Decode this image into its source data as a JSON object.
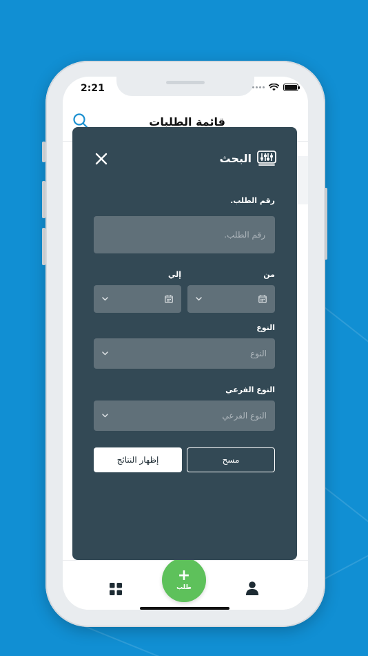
{
  "status_bar": {
    "time": "2:21"
  },
  "header": {
    "title": "قائمة الطلبات"
  },
  "search_modal": {
    "title": "البحث",
    "order_number": {
      "label": "رقم الطلب.",
      "placeholder": "رقم الطلب."
    },
    "date_from": {
      "label": "من"
    },
    "date_to": {
      "label": "إلي"
    },
    "type": {
      "label": "النوع",
      "placeholder": "النوع"
    },
    "subtype": {
      "label": "النوع الفرعي",
      "placeholder": "النوع الفرعي"
    },
    "show_results_label": "إظهار النتائج",
    "clear_label": "مسح"
  },
  "tab_bar": {
    "fab_label": "طلب"
  },
  "icons": {
    "filter": "sliders-icon",
    "close": "close-icon",
    "search": "search-icon",
    "calendar": "calendar-icon",
    "chevron": "chevron-down-icon",
    "grid": "grid-icon",
    "user": "user-icon",
    "plus": "plus-icon"
  },
  "colors": {
    "background": "#118fd3",
    "modal": "#334955",
    "field": "#607079",
    "fab": "#5ec15b",
    "accent": "#1a8fd0"
  }
}
